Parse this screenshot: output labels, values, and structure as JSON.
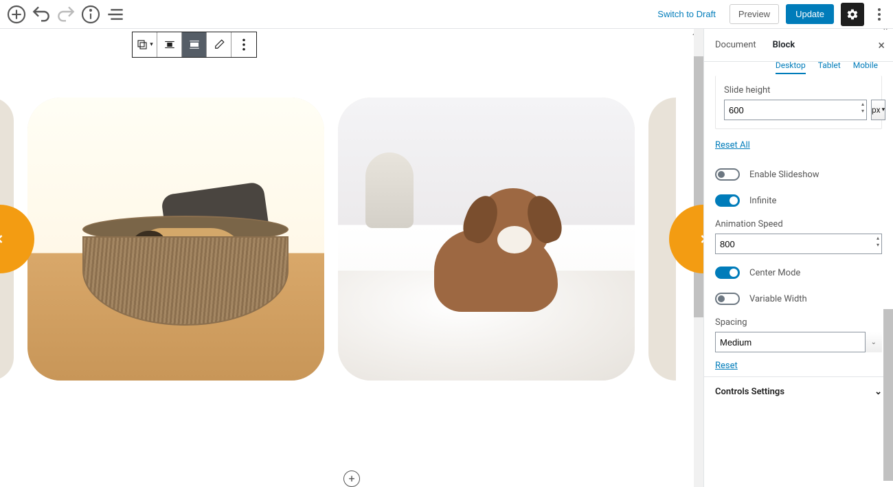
{
  "top_toolbar": {
    "switch_to_draft": "Switch to Draft",
    "preview": "Preview",
    "update": "Update"
  },
  "sidebar": {
    "tabs": {
      "document": "Document",
      "block": "Block"
    },
    "device_tabs": {
      "desktop": "Desktop",
      "tablet": "Tablet",
      "mobile": "Mobile"
    },
    "slide_height": {
      "label": "Slide height",
      "value": "600",
      "unit": "px"
    },
    "reset_all": "Reset All",
    "enable_slideshow": {
      "label": "Enable Slideshow",
      "on": false
    },
    "infinite": {
      "label": "Infinite",
      "on": true
    },
    "animation_speed": {
      "label": "Animation Speed",
      "value": "800"
    },
    "center_mode": {
      "label": "Center Mode",
      "on": true
    },
    "variable_width": {
      "label": "Variable Width",
      "on": false
    },
    "spacing": {
      "label": "Spacing",
      "value": "Medium"
    },
    "reset": "Reset",
    "controls_settings": "Controls Settings"
  }
}
